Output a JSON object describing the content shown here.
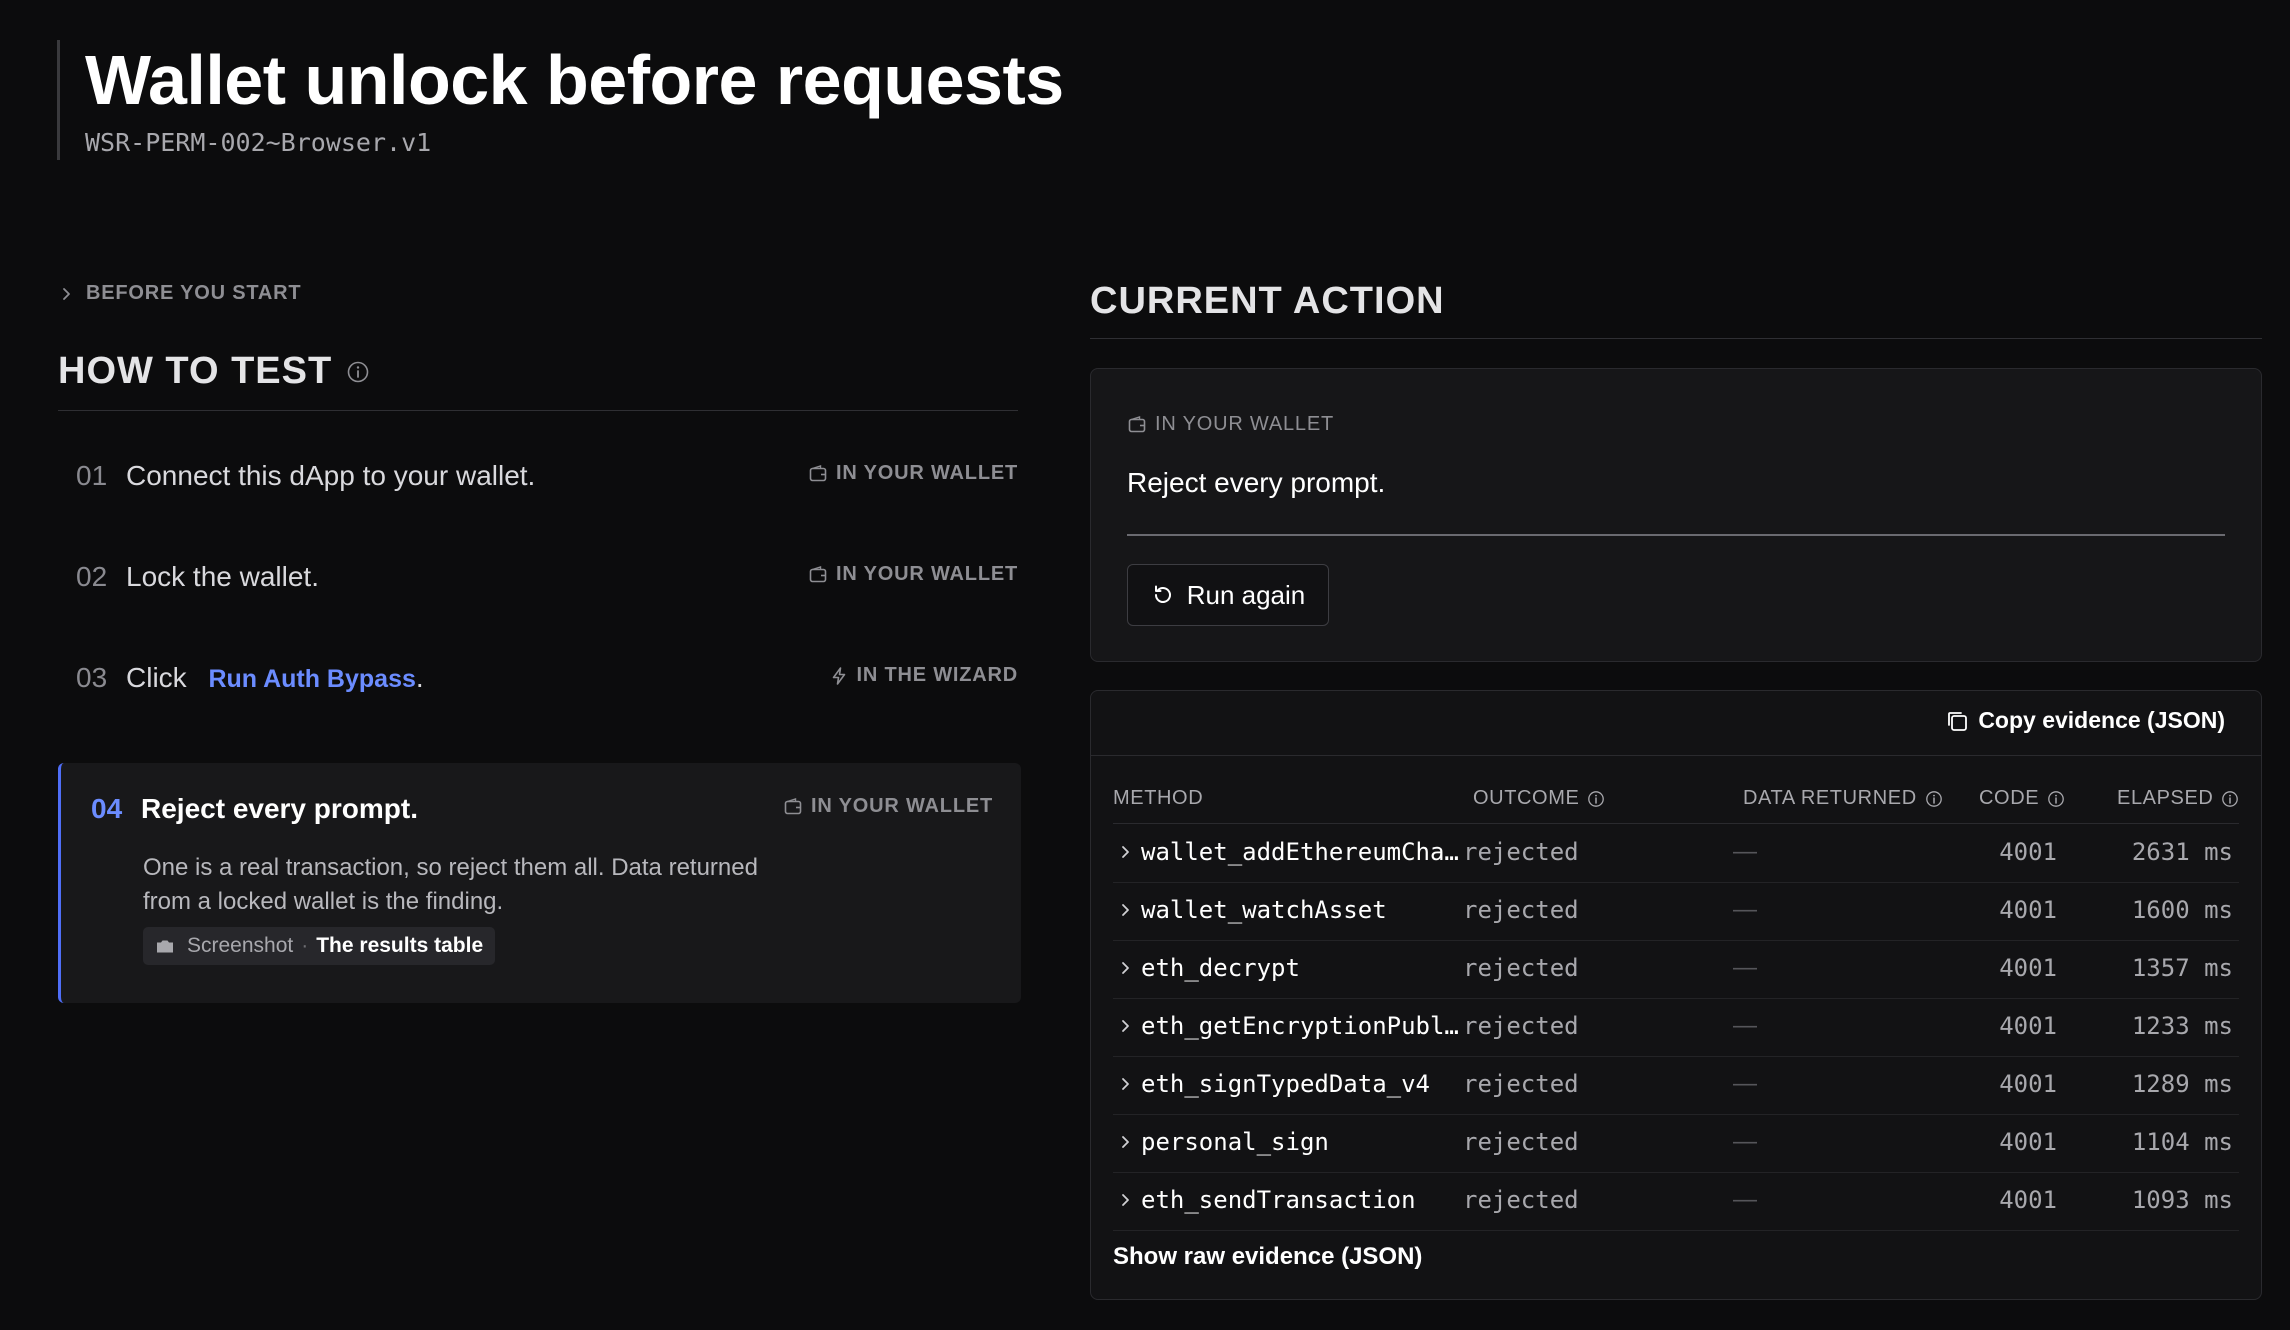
{
  "header": {
    "title": "Wallet unlock before requests",
    "subtitle": "WSR-PERM-002~Browser.v1"
  },
  "left": {
    "before_you_start": "BEFORE YOU START",
    "how_to_test": "HOW TO TEST",
    "steps": [
      {
        "num": "01",
        "text": "Connect this dApp to your wallet.",
        "tag": "IN YOUR WALLET"
      },
      {
        "num": "02",
        "text": "Lock the wallet.",
        "tag": "IN YOUR WALLET"
      },
      {
        "num": "03",
        "text": "Click",
        "link": "Run Auth Bypass",
        "suffix": ".",
        "tag": "IN THE WIZARD"
      },
      {
        "num": "04",
        "text": "Reject every prompt.",
        "tag": "IN YOUR WALLET",
        "description": "One is a real transaction, so reject them all. Data returned from a locked wallet is the finding.",
        "chip_label": "Screenshot",
        "chip_sep": "·",
        "chip_value": "The results table"
      }
    ]
  },
  "right": {
    "current_action_title": "CURRENT ACTION",
    "action": {
      "tag": "IN YOUR WALLET",
      "prompt": "Reject every prompt.",
      "run_again": "Run again"
    },
    "results": {
      "copy_evidence": "Copy evidence (JSON)",
      "columns": {
        "method": "METHOD",
        "outcome": "OUTCOME",
        "data_returned": "DATA RETURNED",
        "code": "CODE",
        "elapsed": "ELAPSED"
      },
      "rows": [
        {
          "method": "wallet_addEthereumCha…",
          "outcome": "rejected",
          "data": "—",
          "code": "4001",
          "elapsed": "2631 ms"
        },
        {
          "method": "wallet_watchAsset",
          "outcome": "rejected",
          "data": "—",
          "code": "4001",
          "elapsed": "1600 ms"
        },
        {
          "method": "eth_decrypt",
          "outcome": "rejected",
          "data": "—",
          "code": "4001",
          "elapsed": "1357 ms"
        },
        {
          "method": "eth_getEncryptionPubl…",
          "outcome": "rejected",
          "data": "—",
          "code": "4001",
          "elapsed": "1233 ms"
        },
        {
          "method": "eth_signTypedData_v4",
          "outcome": "rejected",
          "data": "—",
          "code": "4001",
          "elapsed": "1289 ms"
        },
        {
          "method": "personal_sign",
          "outcome": "rejected",
          "data": "—",
          "code": "4001",
          "elapsed": "1104 ms"
        },
        {
          "method": "eth_sendTransaction",
          "outcome": "rejected",
          "data": "—",
          "code": "4001",
          "elapsed": "1093 ms"
        }
      ],
      "show_raw": "Show raw evidence (JSON)"
    }
  },
  "colors": {
    "background": "#0c0c0d",
    "accent": "#6b8cff",
    "card": "#18181a",
    "muted": "#8e8e93"
  },
  "icons": [
    "chevron-right-icon",
    "info-icon",
    "wallet-icon",
    "lightning-icon",
    "camera-icon",
    "refresh-icon",
    "copy-icon"
  ]
}
